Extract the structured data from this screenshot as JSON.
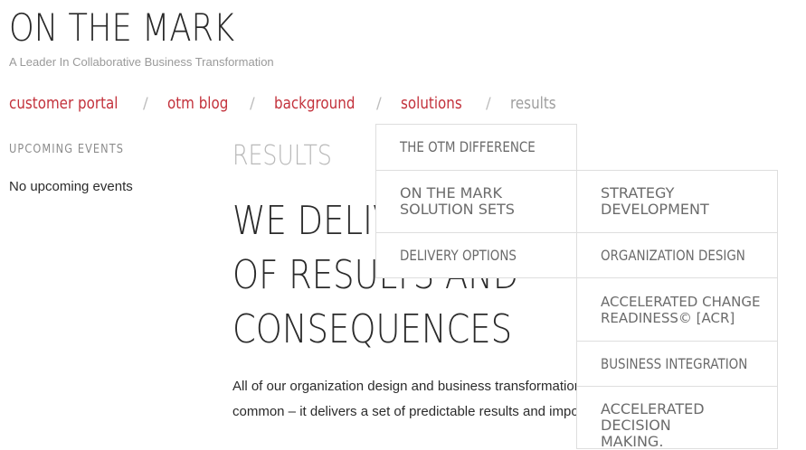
{
  "header": {
    "site_title": "ON THE MARK",
    "tagline": "A Leader In Collaborative Business Transformation"
  },
  "nav": {
    "items": [
      {
        "label": "customer portal"
      },
      {
        "label": "otm blog"
      },
      {
        "label": "background"
      },
      {
        "label": "solutions"
      },
      {
        "label": "results"
      }
    ],
    "separator": "/",
    "active_color": "#c3323c",
    "current_color": "#9e9e9e"
  },
  "sidebar": {
    "events_heading": "UPCOMING EVENTS",
    "events_empty": "No upcoming events"
  },
  "main": {
    "page_title": "RESULTS",
    "headline_lines": [
      "WE DELIVER A SET",
      "OF RESULTS AND",
      "CONSEQUENCES"
    ],
    "body_lines": [
      "All of our organization design and business transformation work has one thing in",
      "common – it delivers a set of predictable results and important consequences."
    ]
  },
  "solutions_menu": {
    "items": [
      {
        "label": "THE OTM DIFFERENCE"
      },
      {
        "label": "ON THE MARK SOLUTION SETS"
      },
      {
        "label": "DELIVERY OPTIONS"
      }
    ]
  },
  "solution_sets_submenu": {
    "items": [
      {
        "label": "STRATEGY DEVELOPMENT"
      },
      {
        "label": "ORGANIZATION DESIGN"
      },
      {
        "label": "ACCELERATED CHANGE READINESS© [ACR]"
      },
      {
        "label": "BUSINESS INTEGRATION"
      },
      {
        "label": "ACCELERATED DECISION MAKING."
      }
    ]
  }
}
